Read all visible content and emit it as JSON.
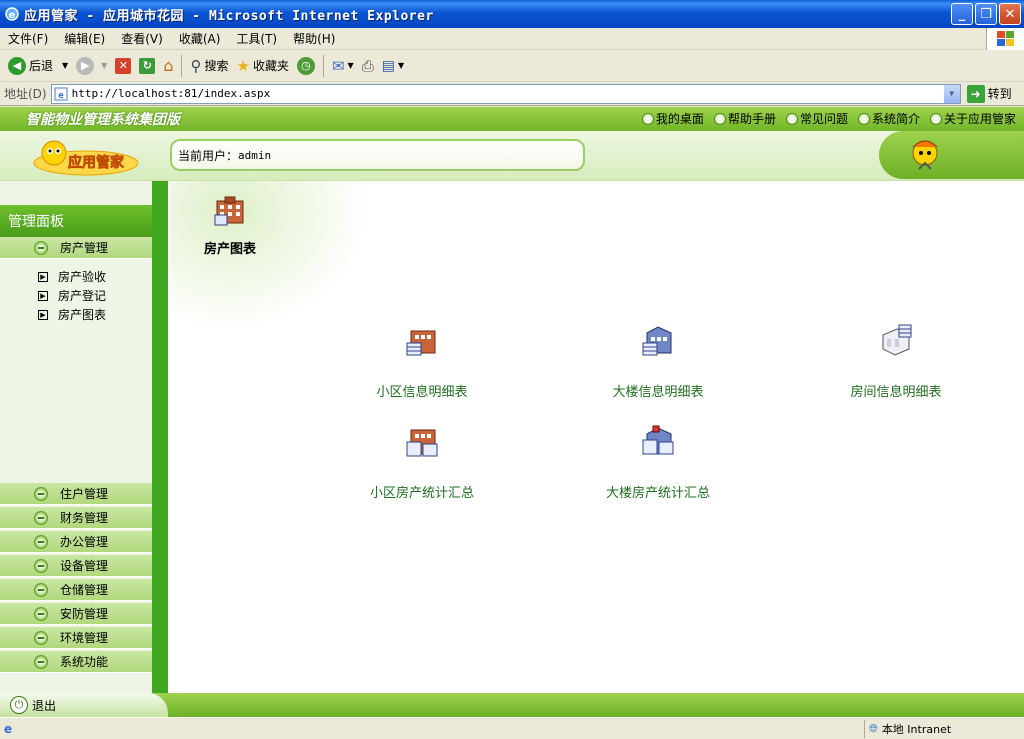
{
  "window": {
    "title": "应用管家 - 应用城市花园 - Microsoft Internet Explorer",
    "controls": [
      "minimize",
      "restore",
      "close"
    ]
  },
  "menubar": {
    "items": [
      "文件(F)",
      "编辑(E)",
      "查看(V)",
      "收藏(A)",
      "工具(T)",
      "帮助(H)"
    ]
  },
  "toolbar": {
    "back_label": "后退",
    "search_label": "搜索",
    "favorites_label": "收藏夹"
  },
  "addressbar": {
    "label": "地址(D)",
    "url": "http://localhost:81/index.aspx",
    "go_label": "转到"
  },
  "app": {
    "title": "智能物业管理系统集团版",
    "top_links": [
      "我的桌面",
      "帮助手册",
      "常见问题",
      "系统简介",
      "关于应用管家"
    ],
    "user_label": "当前用户：",
    "user_value": "admin",
    "logo_text": "应用管家",
    "panel_title": "管理面板",
    "nav_active": "房产管理",
    "sub_items": [
      "房产验收",
      "房产登记",
      "房产图表"
    ],
    "nav_items": [
      "住户管理",
      "财务管理",
      "办公管理",
      "设备管理",
      "仓储管理",
      "安防管理",
      "环境管理",
      "系统功能"
    ],
    "exit_label": "退出"
  },
  "main": {
    "page_title": "房产图表",
    "reports": [
      "小区信息明细表",
      "大楼信息明细表",
      "房间信息明细表",
      "小区房产统计汇总",
      "大楼房产统计汇总"
    ]
  },
  "statusbar": {
    "zone": "本地 Intranet"
  },
  "colors": {
    "accent_green": "#72b628",
    "link_green": "#1f6f1f",
    "xp_blue": "#0a55d3"
  }
}
